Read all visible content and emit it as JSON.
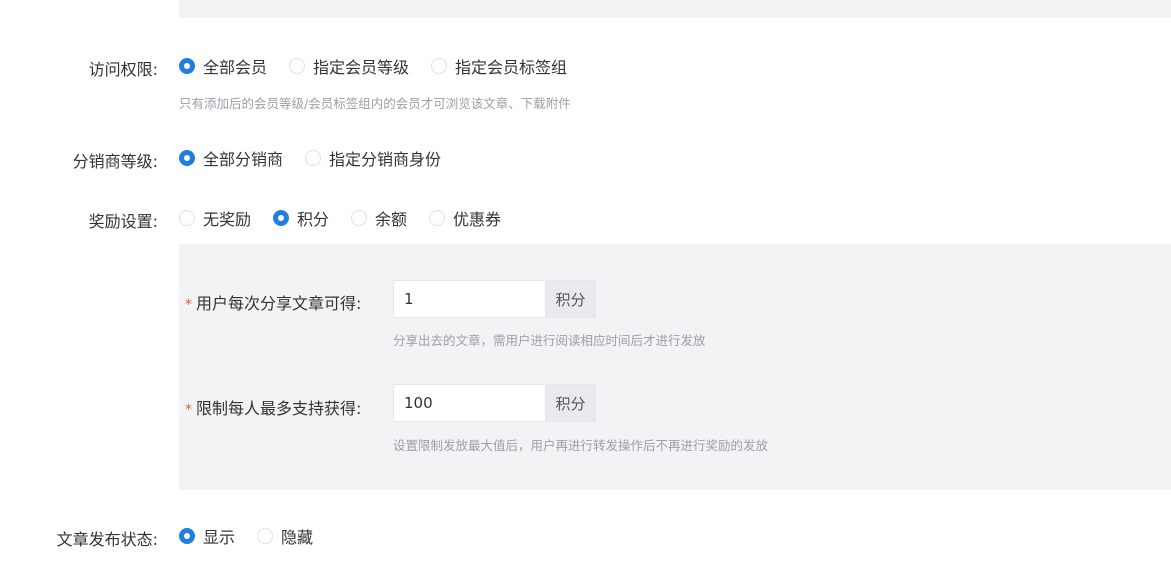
{
  "access": {
    "label": "访问权限:",
    "options": [
      "全部会员",
      "指定会员等级",
      "指定会员标签组"
    ],
    "selected": 0,
    "hint": "只有添加后的会员等级/会员标签组内的会员才可浏览该文章、下载附件"
  },
  "distributor": {
    "label": "分销商等级:",
    "options": [
      "全部分销商",
      "指定分销商身份"
    ],
    "selected": 0
  },
  "reward": {
    "label": "奖励设置:",
    "options": [
      "无奖励",
      "积分",
      "余额",
      "优惠券"
    ],
    "selected": 1,
    "share": {
      "required_mark": "*",
      "label": "用户每次分享文章可得:",
      "value": "1",
      "suffix": "积分",
      "hint": "分享出去的文章，需用户进行阅读相应时间后才进行发放"
    },
    "limit": {
      "required_mark": "*",
      "label": "限制每人最多支持获得:",
      "value": "100",
      "suffix": "积分",
      "hint": "设置限制发放最大值后，用户再进行转发操作后不再进行奖励的发放"
    }
  },
  "publish": {
    "label": "文章发布状态:",
    "options": [
      "显示",
      "隐藏"
    ],
    "selected": 0
  },
  "colors": {
    "accent": "#1f7ee0",
    "panel_bg": "#f2f3f5",
    "required": "#e25c3f"
  }
}
